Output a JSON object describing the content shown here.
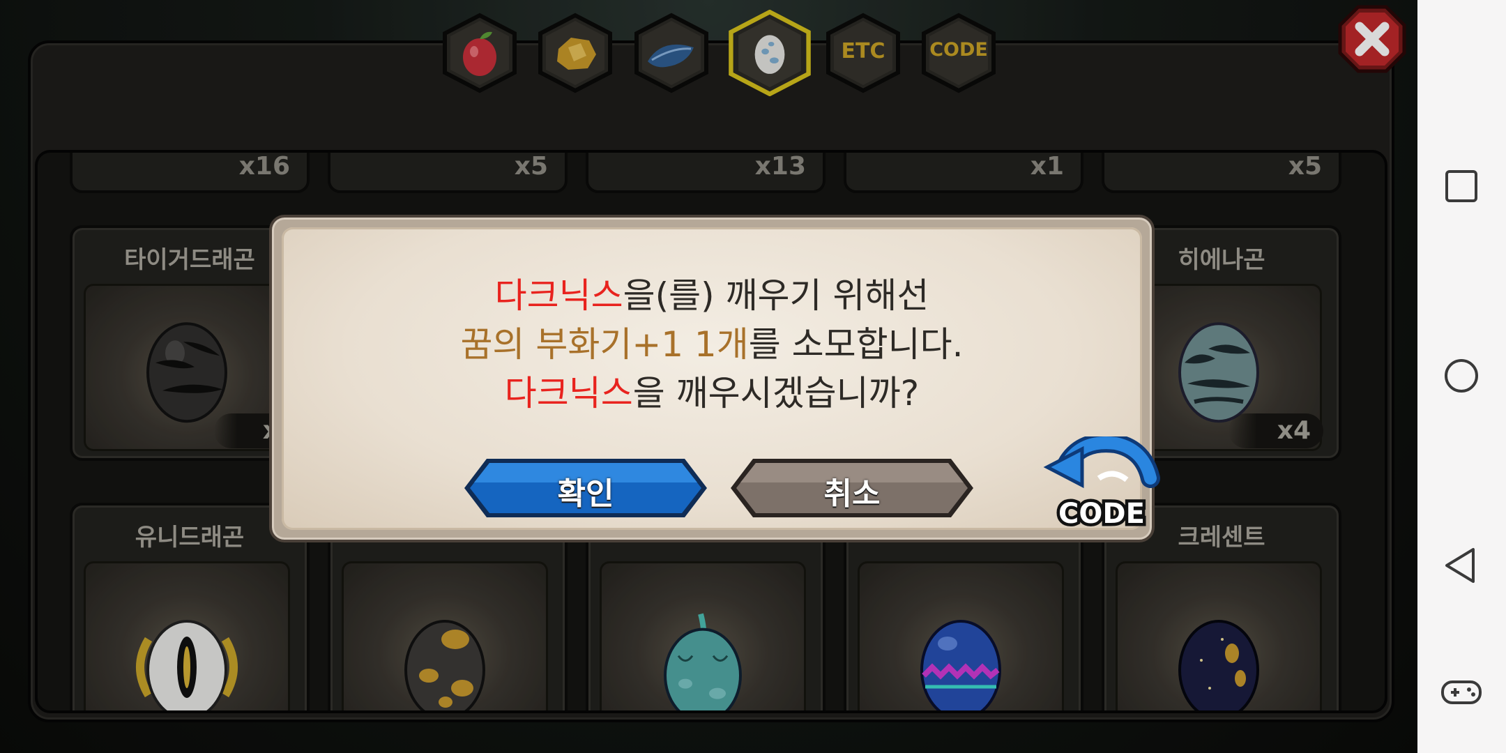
{
  "tabs": [
    {
      "name": "fruit",
      "icon": "red-fruit-icon"
    },
    {
      "name": "gold",
      "icon": "gold-ore-icon"
    },
    {
      "name": "feather",
      "icon": "blue-feather-icon"
    },
    {
      "name": "egg",
      "icon": "egg-icon",
      "selected": true
    },
    {
      "name": "etc",
      "label": "ETC"
    },
    {
      "name": "code",
      "label": "CODE"
    }
  ],
  "top_row_counts": [
    "x16",
    "x5",
    "x13",
    "x1",
    "x5"
  ],
  "cards_row2": [
    {
      "name": "타이거드래곤",
      "count": "x",
      "egg": "dark-striped"
    },
    {
      "name": "히에나곤",
      "count": "x4",
      "egg": "teal-striped"
    }
  ],
  "cards_row3": [
    {
      "name": "유니드래곤",
      "egg": "white-gold-eye"
    },
    {
      "name": "",
      "egg": "black-gold-spots"
    },
    {
      "name": "",
      "egg": "teal-feather"
    },
    {
      "name": "",
      "egg": "blue-zigzag"
    },
    {
      "name": "크레센트",
      "egg": "night-gold"
    }
  ],
  "dialog": {
    "line1_highlight": "다크닉스",
    "line1_rest": "을(를) 깨우기 위해선",
    "line2_highlight": "꿈의 부화기+1 1개",
    "line2_rest": "를 소모합니다.",
    "line3_highlight": "다크닉스",
    "line3_rest": "을 깨우시겠습니까?",
    "confirm_label": "확인",
    "cancel_label": "취소",
    "code_badge_label": "CODE"
  },
  "colors": {
    "highlight_red": "#e8231e",
    "highlight_gold": "#a8712a",
    "confirm_blue": "#1565c0",
    "cancel_gray": "#7d7169",
    "tab_gold": "#c9a326"
  }
}
